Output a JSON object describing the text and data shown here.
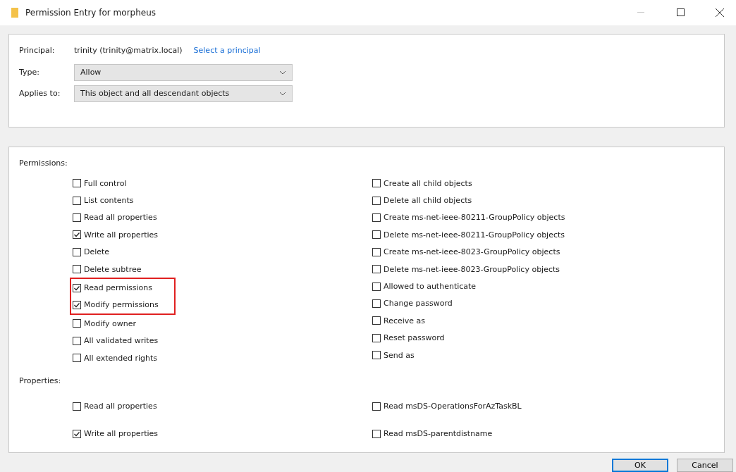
{
  "window": {
    "title": "Permission Entry for morpheus",
    "minimize_disabled": true
  },
  "principal": {
    "label": "Principal:",
    "value": "trinity (trinity@matrix.local)",
    "link": "Select a principal"
  },
  "type": {
    "label": "Type:",
    "value": "Allow"
  },
  "applies_to": {
    "label": "Applies to:",
    "value": "This object and all descendant objects"
  },
  "permissions": {
    "label": "Permissions:",
    "left": [
      {
        "label": "Full control",
        "checked": false,
        "highlighted": false
      },
      {
        "label": "List contents",
        "checked": false,
        "highlighted": false
      },
      {
        "label": "Read all properties",
        "checked": false,
        "highlighted": false
      },
      {
        "label": "Write all properties",
        "checked": true,
        "highlighted": false
      },
      {
        "label": "Delete",
        "checked": false,
        "highlighted": false
      },
      {
        "label": "Delete subtree",
        "checked": false,
        "highlighted": false
      },
      {
        "label": "Read permissions",
        "checked": true,
        "highlighted": true
      },
      {
        "label": "Modify permissions",
        "checked": true,
        "highlighted": true
      },
      {
        "label": "Modify owner",
        "checked": false,
        "highlighted": false
      },
      {
        "label": "All validated writes",
        "checked": false,
        "highlighted": false
      },
      {
        "label": "All extended rights",
        "checked": false,
        "highlighted": false
      }
    ],
    "right": [
      {
        "label": "Create all child objects",
        "checked": false,
        "highlighted": false
      },
      {
        "label": "Delete all child objects",
        "checked": false,
        "highlighted": false
      },
      {
        "label": "Create ms-net-ieee-80211-GroupPolicy objects",
        "checked": false,
        "highlighted": false
      },
      {
        "label": "Delete ms-net-ieee-80211-GroupPolicy objects",
        "checked": false,
        "highlighted": false
      },
      {
        "label": "Create ms-net-ieee-8023-GroupPolicy objects",
        "checked": false,
        "highlighted": false
      },
      {
        "label": "Delete ms-net-ieee-8023-GroupPolicy objects",
        "checked": false,
        "highlighted": false
      },
      {
        "label": "Allowed to authenticate",
        "checked": false,
        "highlighted": false
      },
      {
        "label": "Change password",
        "checked": false,
        "highlighted": false
      },
      {
        "label": "Receive as",
        "checked": false,
        "highlighted": false
      },
      {
        "label": "Reset password",
        "checked": false,
        "highlighted": false
      },
      {
        "label": "Send as",
        "checked": false,
        "highlighted": false
      }
    ]
  },
  "properties": {
    "label": "Properties:",
    "left": [
      {
        "label": "Read all properties",
        "checked": false,
        "highlighted": false
      },
      {
        "label": "Write all properties",
        "checked": true,
        "highlighted": false
      }
    ],
    "right": [
      {
        "label": "Read msDS-OperationsForAzTaskBL",
        "checked": false,
        "highlighted": false
      },
      {
        "label": "Read msDS-parentdistname",
        "checked": false,
        "highlighted": false
      }
    ]
  },
  "buttons": [
    "OK",
    "Cancel"
  ]
}
